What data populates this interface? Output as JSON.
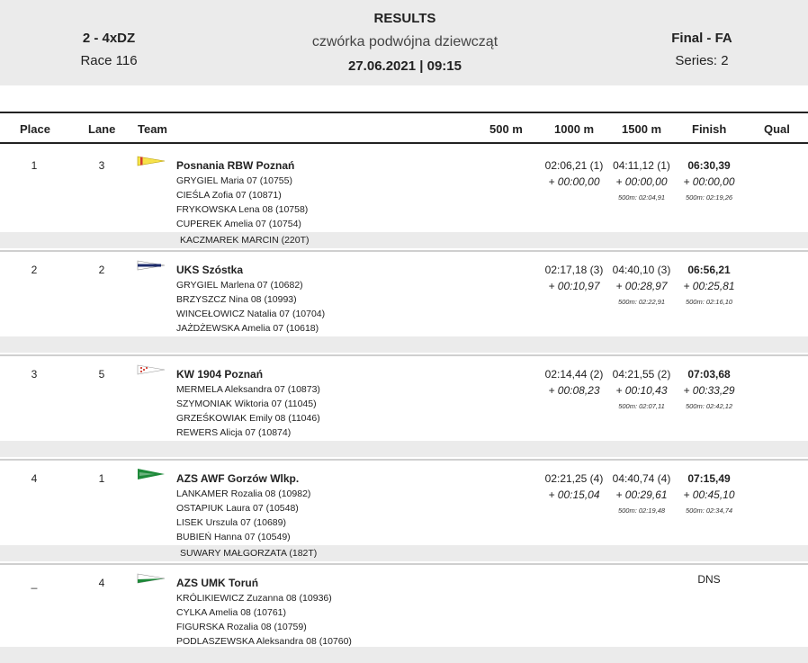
{
  "header": {
    "event_code": "2 - 4xDZ",
    "race": "Race 116",
    "title": "RESULTS",
    "event_name": "czwórka podwójna dziewcząt",
    "datetime": "27.06.2021 | 09:15",
    "phase": "Final - FA",
    "series": "Series: 2"
  },
  "columns": {
    "place": "Place",
    "lane": "Lane",
    "team": "Team",
    "m500": "500 m",
    "m1000": "1000 m",
    "m1500": "1500 m",
    "finish": "Finish",
    "qual": "Qual"
  },
  "results": [
    {
      "place": "1",
      "lane": "3",
      "team": "Posnania RBW Poznań",
      "flag": {
        "name": "posnania-flag-icon",
        "colors": [
          "#f7e24a",
          "#d23b2f"
        ]
      },
      "rowers": [
        "GRYGIEL  Maria 07 (10755)",
        "CIEŚLA  Zofia 07 (10871)",
        "FRYKOWSKA  Lena 08 (10758)",
        "CUPEREK  Amelia 07 (10754)"
      ],
      "s1000": "02:06,21 (1)",
      "d1000": "+ 00:00,00",
      "s1500": "04:11,12 (1)",
      "d1500": "+ 00:00,00",
      "p1500": "500m: 02:04,91",
      "finish": "06:30,39",
      "dfinish": "+ 00:00,00",
      "pfinish": "500m: 02:19,26",
      "coach": "KACZMAREK MARCIN (220T)"
    },
    {
      "place": "2",
      "lane": "2",
      "team": "UKS Szóstka",
      "flag": {
        "name": "uks-szostka-flag-icon",
        "colors": [
          "#1b2a6b",
          "#ffffff"
        ]
      },
      "rowers": [
        "GRYGIEL  Marlena 07 (10682)",
        "BRZYSZCZ  Nina 08 (10993)",
        "WINCEŁOWICZ  Natalia 07 (10704)",
        "JAŻDŻEWSKA  Amelia 07 (10618)"
      ],
      "s1000": "02:17,18 (3)",
      "d1000": "+ 00:10,97",
      "s1500": "04:40,10 (3)",
      "d1500": "+ 00:28,97",
      "p1500": "500m: 02:22,91",
      "finish": "06:56,21",
      "dfinish": "+ 00:25,81",
      "pfinish": "500m: 02:16,10",
      "coach": ""
    },
    {
      "place": "3",
      "lane": "5",
      "team": "KW 1904 Poznań",
      "flag": {
        "name": "kw-1904-flag-icon",
        "colors": [
          "#ffffff",
          "#d23b2f"
        ]
      },
      "rowers": [
        "MERMELA  Aleksandra 07 (10873)",
        "SZYMONIAK  Wiktoria 07 (11045)",
        "GRZEŚKOWIAK  Emily 08 (11046)",
        "REWERS  Alicja 07 (10874)"
      ],
      "s1000": "02:14,44 (2)",
      "d1000": "+ 00:08,23",
      "s1500": "04:21,55 (2)",
      "d1500": "+ 00:10,43",
      "p1500": "500m: 02:07,11",
      "finish": "07:03,68",
      "dfinish": "+ 00:33,29",
      "pfinish": "500m: 02:42,12",
      "coach": ""
    },
    {
      "place": "4",
      "lane": "1",
      "team": "AZS AWF Gorzów Wlkp.",
      "flag": {
        "name": "azs-awf-gorzow-flag-icon",
        "colors": [
          "#1e8a3a",
          "#ffffff"
        ]
      },
      "rowers": [
        "LANKAMER  Rozalia 08 (10982)",
        "OSTAPIUK  Laura 07 (10548)",
        "LISEK  Urszula 07 (10689)",
        "BUBIEŃ  Hanna 07 (10549)"
      ],
      "s1000": "02:21,25 (4)",
      "d1000": "+ 00:15,04",
      "s1500": "04:40,74 (4)",
      "d1500": "+ 00:29,61",
      "p1500": "500m: 02:19,48",
      "finish": "07:15,49",
      "dfinish": "+ 00:45,10",
      "pfinish": "500m: 02:34,74",
      "coach": "SUWARY MAŁGORZATA (182T)"
    },
    {
      "place": "_",
      "lane": "4",
      "team": "AZS UMK Toruń",
      "flag": {
        "name": "azs-umk-torun-flag-icon",
        "colors": [
          "#1e8a3a",
          "#ffffff"
        ]
      },
      "rowers": [
        "KRÓLIKIEWICZ  Zuzanna 08 (10936)",
        "CYLKA  Amelia 08 (10761)",
        "FIGURSKA  Rozalia 08 (10759)",
        "PODLASZEWSKA  Aleksandra 08 (10760)"
      ],
      "s1000": "",
      "d1000": "",
      "s1500": "",
      "d1500": "",
      "p1500": "",
      "finish": "DNS",
      "dfinish": "",
      "pfinish": "",
      "coach": ""
    }
  ]
}
